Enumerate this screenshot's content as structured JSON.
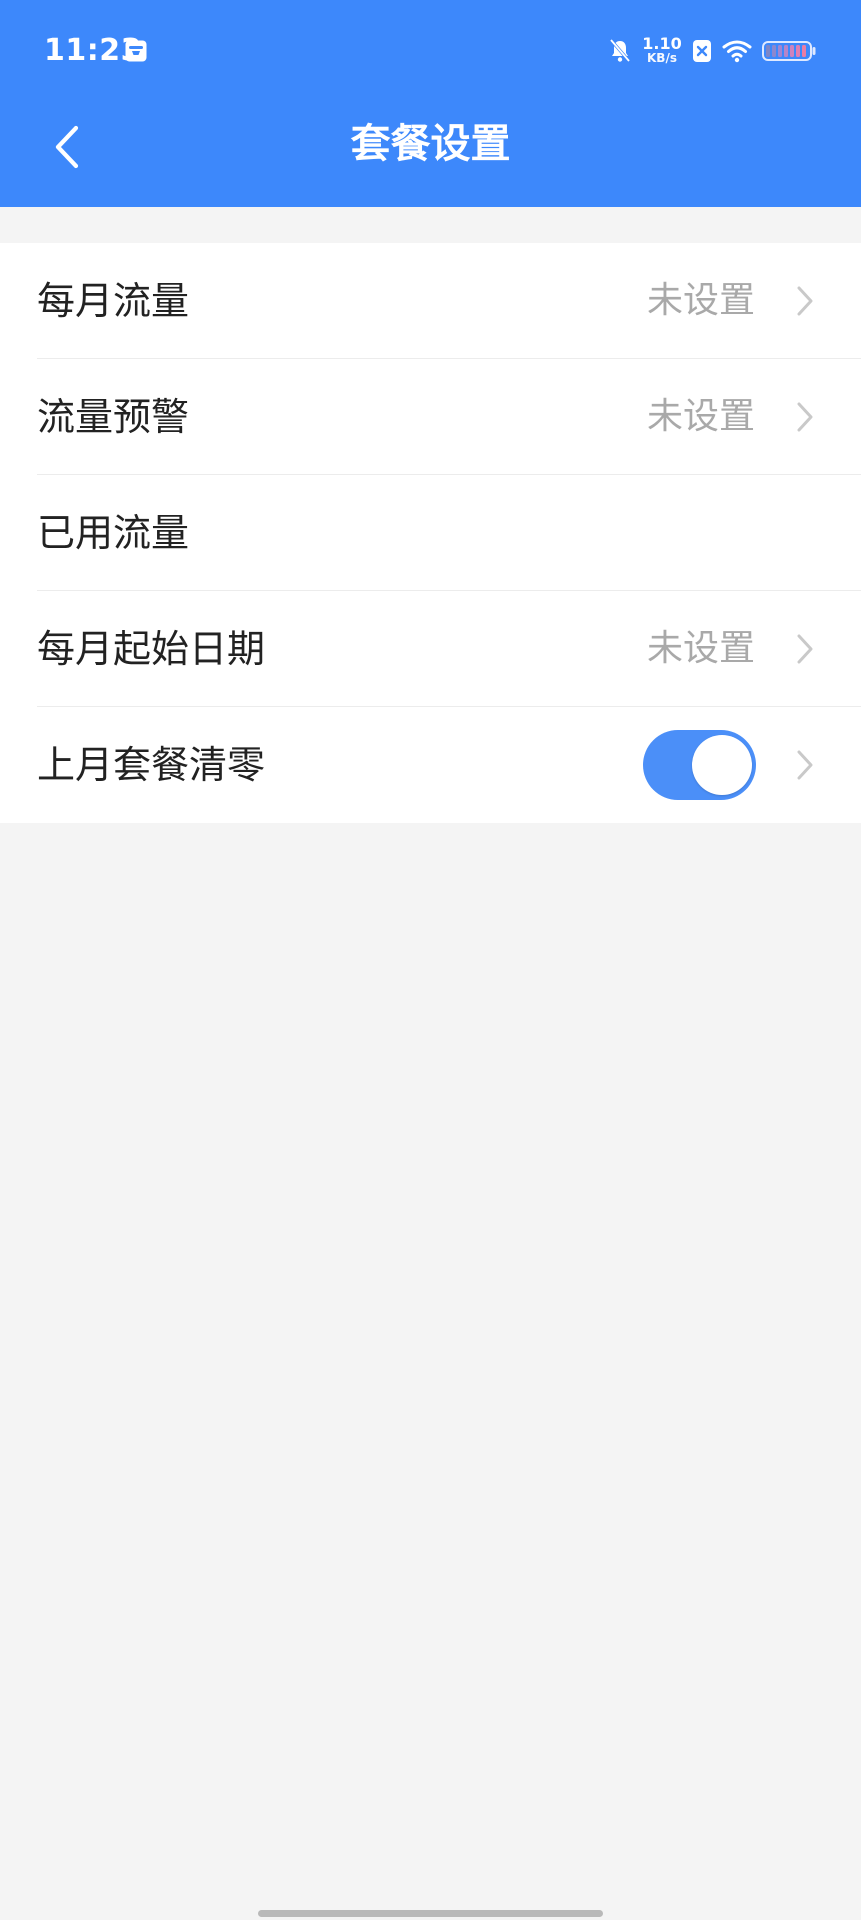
{
  "status_bar": {
    "time": "11:23",
    "network_speed_value": "1.10",
    "network_speed_unit": "KB/s",
    "icons": [
      "calendar-icon",
      "bell-muted-icon",
      "x-box-icon",
      "wifi-icon",
      "battery-icon"
    ]
  },
  "header": {
    "title": "套餐设置",
    "back_icon": "chevron-left-icon"
  },
  "settings": {
    "rows": [
      {
        "label": "每月流量",
        "value": "未设置",
        "has_chevron": true
      },
      {
        "label": "流量预警",
        "value": "未设置",
        "has_chevron": true
      },
      {
        "label": "已用流量",
        "value": "",
        "has_chevron": false
      },
      {
        "label": "每月起始日期",
        "value": "未设置",
        "has_chevron": true
      },
      {
        "label": "上月套餐清零",
        "value": "",
        "toggle_on": true,
        "has_chevron": true
      }
    ]
  },
  "colors": {
    "primary": "#3d88fb",
    "toggle_on": "#4b8ff8",
    "secondary_text": "#a9a9a9",
    "background": "#f4f4f4"
  }
}
